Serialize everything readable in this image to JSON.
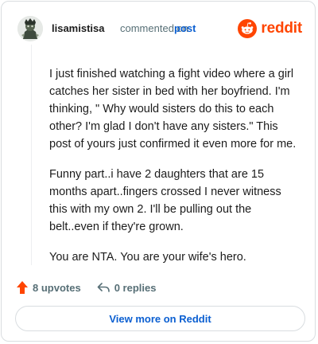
{
  "comment": {
    "username": "lisamistisa",
    "action_text": "commented on",
    "post_link": "post",
    "brand": "reddit",
    "paragraphs": [
      "I just finished watching a fight video where a girl catches her sister in bed with her boyfriend. I'm thinking, \" Why would sisters do this to each other? I'm glad I don't have any sisters.\" This post of yours just confirmed it even more for me.",
      "Funny part..i have 2 daughters that are 15 months apart..fingers crossed I never witness this with my own 2. I'll be pulling out the belt..even if they're grown.",
      "You are NTA. You are your wife's hero."
    ],
    "upvotes": "8 upvotes",
    "replies": "0 replies"
  },
  "actions": {
    "view_more": "View more on Reddit"
  },
  "colors": {
    "brand": "#ff4500",
    "link": "#0b5fd1",
    "muted": "#576f76"
  }
}
